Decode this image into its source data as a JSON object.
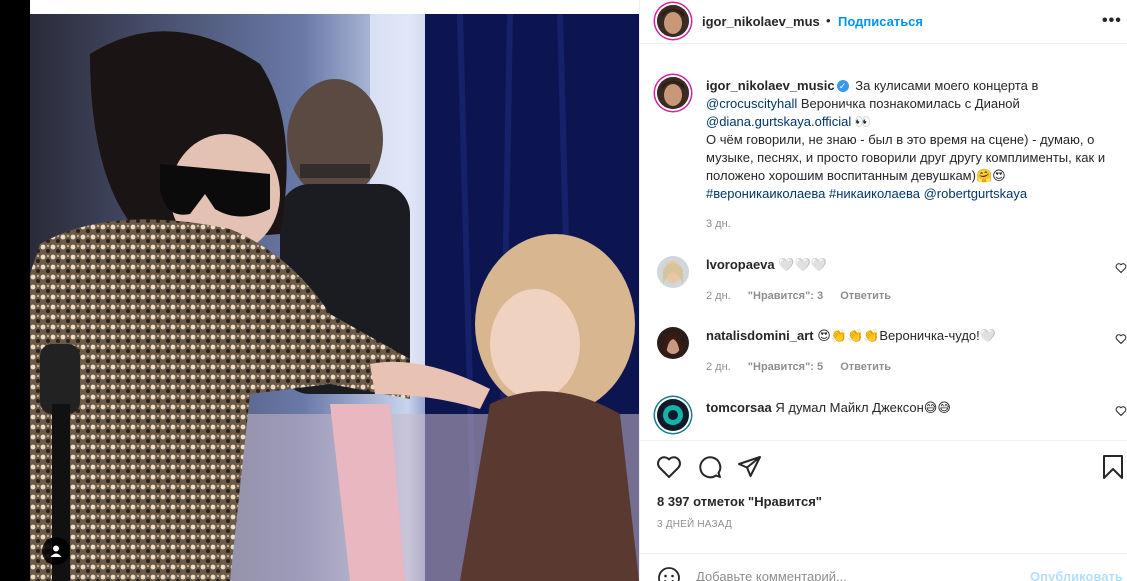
{
  "header": {
    "username": "igor_nikolaev_mus",
    "dot": "•",
    "follow_label": "Подписаться",
    "more": "•••"
  },
  "caption": {
    "username": "igor_nikolaev_music",
    "line1": "За кулисами моего концерта в",
    "mention1": "@crocuscityhall",
    "line2": " Вероничка познакомилась с Дианой",
    "mention2": "@diana.gurtskaya.official",
    "emoji1": " 👀",
    "body": "О чём говорили, не знаю - был в это время на сцене) - думаю, о музыке, песнях, и просто говорили друг другу комплименты, как и положено хорошим воспитанным девушкам)🤗😍",
    "hashtag1": "#вероникаиколаева",
    "hashtag1_full": "#вероникаиколаева",
    "hashtags": "#вероникаиколаева #никаиколаева",
    "mention3": "@robertgurtskaya",
    "time": "3 дн."
  },
  "comments": [
    {
      "username": "lvoropaeva",
      "text": "🤍🤍🤍",
      "time": "2 дн.",
      "likes": "\"Нравится\": 3",
      "reply": "Ответить"
    },
    {
      "username": "natalisdomini_art",
      "text": "😍👏👏👏Вероничка-чудо!🤍",
      "time": "2 дн.",
      "likes": "\"Нравится\": 5",
      "reply": "Ответить"
    },
    {
      "username": "tomcorsaa",
      "text": "Я думал Майкл Джексон😅😅"
    }
  ],
  "likes_count": "8 397 отметок \"Нравится\"",
  "post_date": "3 ДНЕЙ НАЗАД",
  "add_comment": {
    "placeholder": "Добавьте комментарий...",
    "publish_label": "Опубликовать"
  },
  "colors": {
    "accent": "#0095f6",
    "link": "#00376b",
    "muted": "#8e8e8e",
    "publish_disabled": "#b2dffc"
  }
}
